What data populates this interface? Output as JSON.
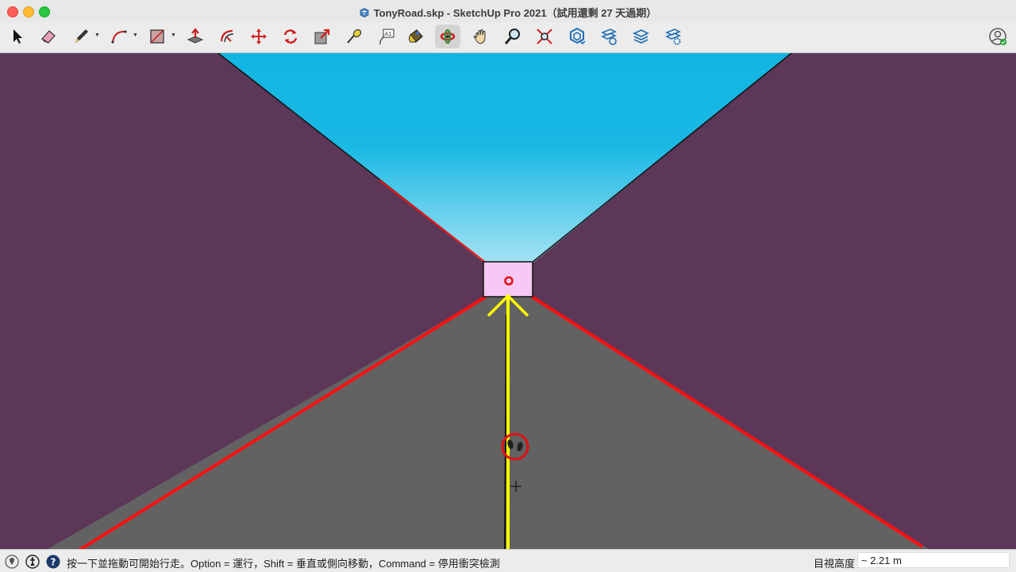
{
  "window": {
    "title": "TonyRoad.skp - SketchUp Pro 2021（試用還剩 27 天過期）"
  },
  "toolbar": {
    "tools": [
      {
        "name": "select-tool",
        "icon": "arrow-cursor-icon"
      },
      {
        "name": "eraser-tool",
        "icon": "eraser-icon"
      },
      {
        "name": "pencil-tool",
        "icon": "pencil-icon"
      },
      {
        "name": "arc-tool",
        "icon": "arc-icon"
      },
      {
        "name": "rectangle-tool",
        "icon": "rectangle-icon"
      },
      {
        "name": "push-pull-tool",
        "icon": "push-pull-icon"
      },
      {
        "name": "offset-tool",
        "icon": "offset-icon"
      },
      {
        "name": "move-tool",
        "icon": "move-icon"
      },
      {
        "name": "rotate-tool",
        "icon": "rotate-icon"
      },
      {
        "name": "scale-tool",
        "icon": "scale-icon"
      },
      {
        "name": "tape-measure-tool",
        "icon": "tape-measure-icon"
      },
      {
        "name": "text-tool",
        "icon": "text-icon"
      },
      {
        "name": "paint-bucket-tool",
        "icon": "paint-bucket-icon"
      },
      {
        "name": "orbit-tool",
        "icon": "orbit-icon"
      },
      {
        "name": "pan-tool",
        "icon": "hand-icon"
      },
      {
        "name": "zoom-tool",
        "icon": "magnifier-icon"
      },
      {
        "name": "zoom-extents-tool",
        "icon": "zoom-extents-icon"
      },
      {
        "name": "3d-warehouse-tool",
        "icon": "warehouse-icon"
      },
      {
        "name": "extension-warehouse-tool",
        "icon": "extension-warehouse-icon"
      },
      {
        "name": "layout-send-tool",
        "icon": "layout-icon"
      },
      {
        "name": "extension-manager-tool",
        "icon": "extension-manager-icon"
      }
    ],
    "account_icon": "user-account-icon"
  },
  "viewport": {
    "colors": {
      "wall": "#5c3758",
      "road": "#626262",
      "sky_top": "#12b5e2",
      "sky_bottom": "#9fe0f2",
      "cube": "#f7c7f5",
      "red_axis": "#ff1010",
      "yellow_guide": "#ffff00"
    },
    "cursor_icon": "footprints-icon"
  },
  "status": {
    "message": "按一下並拖動可開始行走。Option = 運行，Shift = 垂直或側向移動，Command = 停用衝突檢測",
    "vcb_label": "目視高度",
    "vcb_value": "~ 2.21 m"
  }
}
